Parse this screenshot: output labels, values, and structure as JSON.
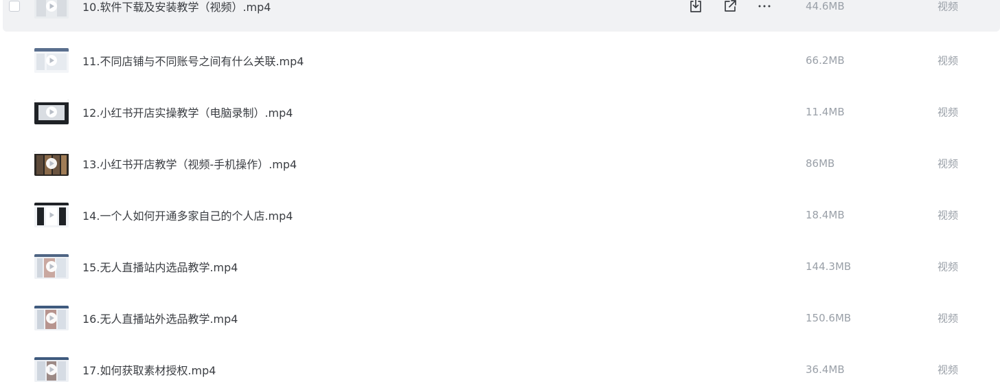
{
  "files": [
    {
      "name": "10.软件下载及安装教学（视频）.mp4",
      "size": "44.6MB",
      "type": "视频",
      "hovered": true
    },
    {
      "name": "11.不同店铺与不同账号之间有什么关联.mp4",
      "size": "66.2MB",
      "type": "视频"
    },
    {
      "name": "12.小红书开店实操教学（电脑录制）.mp4",
      "size": "11.4MB",
      "type": "视频"
    },
    {
      "name": "13.小红书开店教学（视频-手机操作）.mp4",
      "size": "86MB",
      "type": "视频"
    },
    {
      "name": "14.一个人如何开通多家自己的个人店.mp4",
      "size": "18.4MB",
      "type": "视频"
    },
    {
      "name": "15.无人直播站内选品教学.mp4",
      "size": "144.3MB",
      "type": "视频"
    },
    {
      "name": "16.无人直播站外选品教学.mp4",
      "size": "150.6MB",
      "type": "视频"
    },
    {
      "name": "17.如何获取素材授权.mp4",
      "size": "36.4MB",
      "type": "视频"
    }
  ],
  "row_actions": [
    {
      "icon": "download-icon"
    },
    {
      "icon": "share-icon"
    },
    {
      "icon": "more-icon"
    }
  ],
  "colors": {
    "hover_row": "#f1f2f4",
    "name_text": "#3a3d42",
    "meta_text": "#9aa0a8"
  }
}
